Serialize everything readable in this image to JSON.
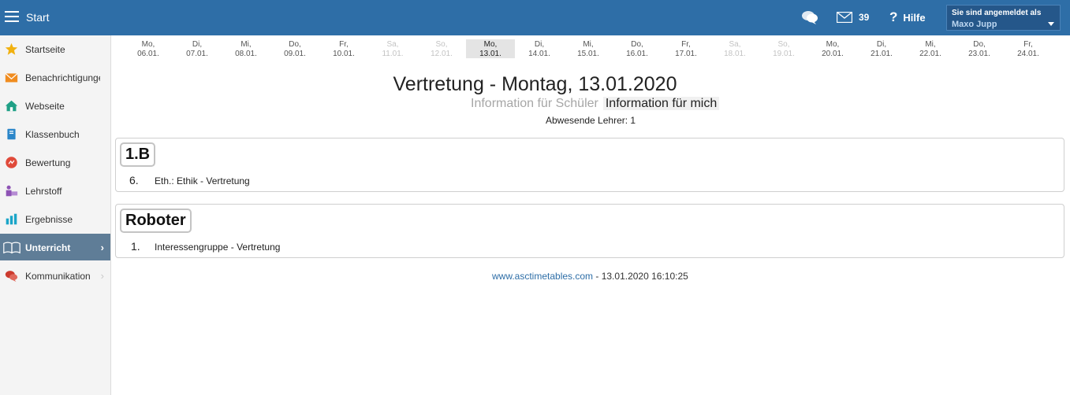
{
  "topbar": {
    "title": "Start",
    "mail_count": "39",
    "help_label": "Hilfe",
    "user_caption": "Sie sind angemeldet als",
    "user_name": "Maxo Jupp"
  },
  "sidebar": {
    "items": [
      {
        "label": "Startseite",
        "icon": "star-icon",
        "color": "#f1b10f"
      },
      {
        "label": "Benachrichtigungen",
        "icon": "envelope-icon",
        "color": "#f08c1f"
      },
      {
        "label": "Webseite",
        "icon": "home-icon",
        "color": "#1fa086"
      },
      {
        "label": "Klassenbuch",
        "icon": "book-icon",
        "color": "#2b86c9"
      },
      {
        "label": "Bewertung",
        "icon": "grade-icon",
        "color": "#e04a3a"
      },
      {
        "label": "Lehrstoff",
        "icon": "teacher-icon",
        "color": "#8e53b5"
      },
      {
        "label": "Ergebnisse",
        "icon": "bar-chart-icon",
        "color": "#1aa5c8"
      },
      {
        "label": "Unterricht",
        "icon": "open-book-icon",
        "color": "#ffffff"
      },
      {
        "label": "Kommunikation",
        "icon": "speech-bubbles-icon",
        "color": "#cc3b2e"
      }
    ]
  },
  "days": [
    {
      "wd": "Mo,",
      "date": "06.01."
    },
    {
      "wd": "Di,",
      "date": "07.01."
    },
    {
      "wd": "Mi,",
      "date": "08.01."
    },
    {
      "wd": "Do,",
      "date": "09.01."
    },
    {
      "wd": "Fr,",
      "date": "10.01."
    },
    {
      "wd": "Sa,",
      "date": "11.01."
    },
    {
      "wd": "So,",
      "date": "12.01."
    },
    {
      "wd": "Mo,",
      "date": "13.01."
    },
    {
      "wd": "Di,",
      "date": "14.01."
    },
    {
      "wd": "Mi,",
      "date": "15.01."
    },
    {
      "wd": "Do,",
      "date": "16.01."
    },
    {
      "wd": "Fr,",
      "date": "17.01."
    },
    {
      "wd": "Sa,",
      "date": "18.01."
    },
    {
      "wd": "So,",
      "date": "19.01."
    },
    {
      "wd": "Mo,",
      "date": "20.01."
    },
    {
      "wd": "Di,",
      "date": "21.01."
    },
    {
      "wd": "Mi,",
      "date": "22.01."
    },
    {
      "wd": "Do,",
      "date": "23.01."
    },
    {
      "wd": "Fr,",
      "date": "24.01."
    }
  ],
  "selected_day": "13.01.",
  "main": {
    "title": "Vertretung - Montag, 13.01.2020",
    "tab_students": "Information für Schüler",
    "tab_me": "Information für mich",
    "absent": "Abwesende Lehrer: 1",
    "cards": [
      {
        "name": "1.B",
        "period": "6.",
        "text": "Eth.: Ethik - Vertretung"
      },
      {
        "name": "Roboter",
        "period": "1.",
        "text": "Interessengruppe - Vertretung"
      }
    ],
    "footer_link": "www.asctimetables.com",
    "footer_text": " - 13.01.2020 16:10:25"
  },
  "colors": {
    "topbar": "#2e6ea7",
    "sidebar_active": "#5f7d97"
  }
}
